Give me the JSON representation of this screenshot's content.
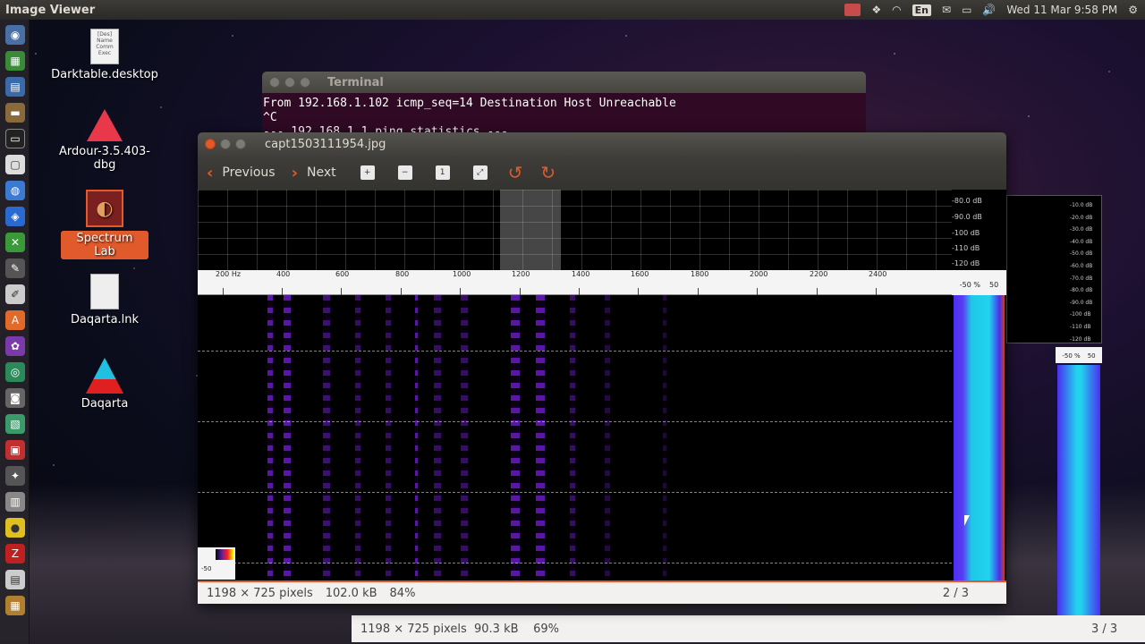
{
  "top_panel": {
    "app_title": "Image Viewer",
    "keyboard_layout": "En",
    "datetime": "Wed 11 Mar  9:58 PM"
  },
  "desktop_icons": [
    {
      "label": "Darktable.desktop",
      "doc_text": "[Des] Name Comm Exec"
    },
    {
      "label": "Ardour-3.5.403-dbg"
    },
    {
      "label": "Spectrum Lab"
    },
    {
      "label": "Daqarta.lnk"
    },
    {
      "label": "Daqarta"
    }
  ],
  "terminal": {
    "title": "Terminal",
    "lines": [
      "From 192.168.1.102 icmp_seq=14 Destination Host Unreachable",
      "^C",
      "--- 192.168.1.1 ping statistics ---"
    ]
  },
  "viewer": {
    "filename": "capt1503111954.jpg",
    "prev_label": "Previous",
    "next_label": "Next",
    "status_dims": "1198 × 725 pixels",
    "status_size": "102.0 kB",
    "status_zoom": "84%",
    "status_count": "2 / 3",
    "spectrum": {
      "freq_ticks": [
        "200 Hz",
        "400",
        "600",
        "800",
        "1000",
        "1200",
        "1400",
        "1600",
        "1800",
        "2000",
        "2200",
        "2400"
      ],
      "db_ticks": [
        "-80.0 dB",
        "-90.0 dB",
        "-100 dB",
        "-110 dB",
        "-120 dB"
      ],
      "meter_ticks": [
        "-50 %",
        "50"
      ],
      "colorbar_label": "-50"
    }
  },
  "viewer_back": {
    "status_dims": "1198 × 725 pixels",
    "status_size": "90.3 kB",
    "status_zoom": "69%",
    "status_count": "3 / 3",
    "db_ticks": [
      "-10.0 dB",
      "-20.0 dB",
      "-30.0 dB",
      "-40.0 dB",
      "-50.0 dB",
      "-60.0 dB",
      "-70.0 dB",
      "-80.0 dB",
      "-90.0 dB",
      "-100 dB",
      "-110 dB",
      "-120 dB"
    ],
    "meter_ticks": [
      "-50 %",
      "50"
    ]
  }
}
